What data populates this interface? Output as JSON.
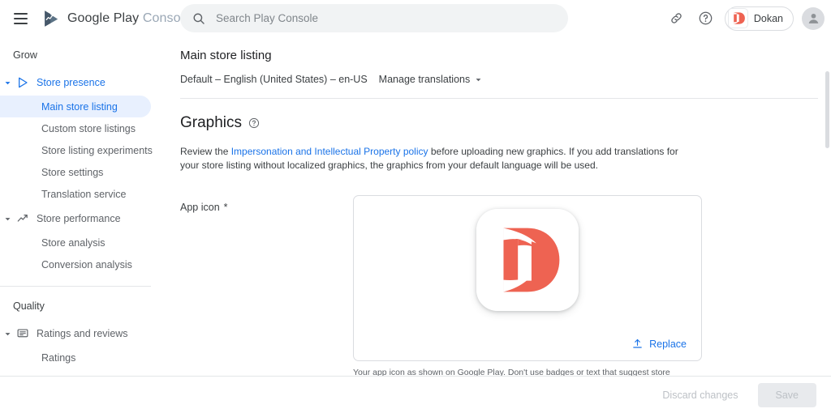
{
  "topbar": {
    "menu_icon": "hamburger-menu-icon",
    "brand_google_play": "Google Play",
    "brand_console": "Console",
    "logo_icon": "google-play-console-logo-icon",
    "search": {
      "placeholder": "Search Play Console",
      "value": "",
      "icon": "search-icon"
    },
    "link_icon": "link-icon",
    "help_icon": "help-circle-icon",
    "app_chip": {
      "name": "Dokan",
      "logo_letter": "D",
      "logo_color": "#ee6352"
    },
    "account_avatar_icon": "account-avatar-icon"
  },
  "sidebar": {
    "groups": [
      {
        "title": "Grow",
        "items": [
          {
            "label": "Store presence",
            "icon": "play-triangle-icon",
            "chevron": "chevron-down-icon",
            "active": true,
            "children": [
              {
                "label": "Main store listing",
                "selected": true
              },
              {
                "label": "Custom store listings",
                "selected": false
              },
              {
                "label": "Store listing experiments",
                "selected": false
              },
              {
                "label": "Store settings",
                "selected": false
              },
              {
                "label": "Translation service",
                "selected": false
              }
            ]
          },
          {
            "label": "Store performance",
            "icon": "trending-up-icon",
            "chevron": "chevron-down-icon",
            "active": false,
            "children": [
              {
                "label": "Store analysis",
                "selected": false
              },
              {
                "label": "Conversion analysis",
                "selected": false
              }
            ]
          }
        ]
      },
      {
        "title": "Quality",
        "items": [
          {
            "label": "Ratings and reviews",
            "icon": "review-comment-icon",
            "chevron": "chevron-down-icon",
            "active": false,
            "children": [
              {
                "label": "Ratings",
                "selected": false
              }
            ]
          }
        ]
      }
    ]
  },
  "main": {
    "page_title": "Main store listing",
    "locale_text": "Default – English (United States) – en-US",
    "manage_translations_label": "Manage translations",
    "manage_translations_chevron": "chevron-down-icon",
    "graphics": {
      "heading": "Graphics",
      "help_icon": "help-circle-icon",
      "description_before": "Review the ",
      "description_link": "Impersonation and Intellectual Property policy",
      "description_after": " before uploading new graphics. If you add translations for your store listing without localized graphics, the graphics from your default language will be used."
    },
    "app_icon_field": {
      "label": "App icon",
      "required_marker": "*",
      "preview_letter": "D",
      "preview_color": "#ee6352",
      "replace_label": "Replace",
      "replace_icon": "upload-icon",
      "help_text": "Your app icon as shown on Google Play. Don't use badges or text that suggest store ranking, price or Google Play categories (such as \"top\", \"new\", or \"sale\")."
    }
  },
  "bottombar": {
    "discard_label": "Discard changes",
    "save_label": "Save"
  },
  "colors": {
    "accent_blue": "#1a73e8",
    "selected_pill": "#e8f0fe",
    "brand_orange": "#ee6352",
    "text_primary": "#202124",
    "text_secondary": "#5f6368"
  }
}
